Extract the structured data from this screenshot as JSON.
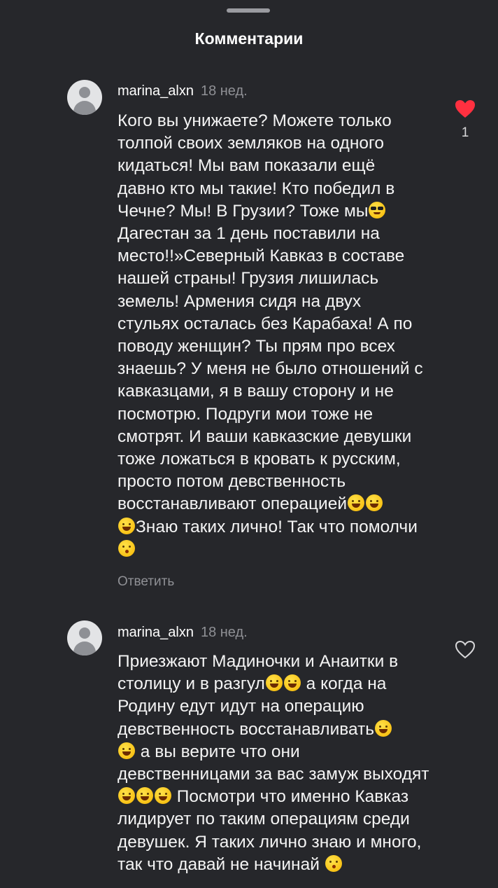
{
  "header": {
    "title": "Комментарии"
  },
  "comments": [
    {
      "username": "marina_alxn",
      "time": "18 нед.",
      "text_parts": [
        "Кого вы унижаете? Можете только толпой своих земляков на одного кидаться! Мы вам показали ещё давно кто мы такие! Кто победил в Чечне? Мы! В Грузии? Тоже мы",
        "\nДагестан за 1 день поставили на место!!»Северный Кавказ в составе нашей страны! Грузия лишилась земель! Армения сидя на двух стульях осталась без Карабаха! А по поводу женщин? Ты прям про всех знаешь? У меня не было отношений с кавказцами, я в вашу сторону и не посмотрю. Подруги мои тоже не смотрят.  И ваши кавказские девушки тоже ложаться в кровать к русским, просто потом девственность восстанавливают операцией",
        "\n",
        "Знаю таких лично! Так что помолчи"
      ],
      "reply_label": "Ответить",
      "liked": true,
      "like_count": "1",
      "emoji": [
        "smiling-face-with-sunglasses",
        "grinning-squinting-face",
        "rolling-on-floor-laughing",
        "rolling-on-floor-laughing",
        "face-blowing-kiss"
      ]
    },
    {
      "username": "marina_alxn",
      "time": "18 нед.",
      "text_parts": [
        "Приезжают Мадиночки и Анаитки в столицу и в разгул",
        " а когда на Родину едут идут на операцию девственность восстанавливать",
        "\n",
        " а вы верите что они девственницами за вас замуж выходят ",
        " Посмотри что именно Кавказ лидирует по таким операциям среди девушек. Я таких лично знаю и много, так что давай не начинай "
      ],
      "liked": false,
      "emoji": [
        "rolling-on-floor-laughing",
        "grinning-squinting-face",
        "rolling-on-floor-laughing",
        "rolling-on-floor-laughing",
        "rolling-on-floor-laughing",
        "rolling-on-floor-laughing",
        "rolling-on-floor-laughing",
        "face-blowing-kiss"
      ]
    }
  ],
  "colors": {
    "background": "#26272b",
    "like_active": "#ff3040",
    "muted_text": "#8f9095"
  }
}
